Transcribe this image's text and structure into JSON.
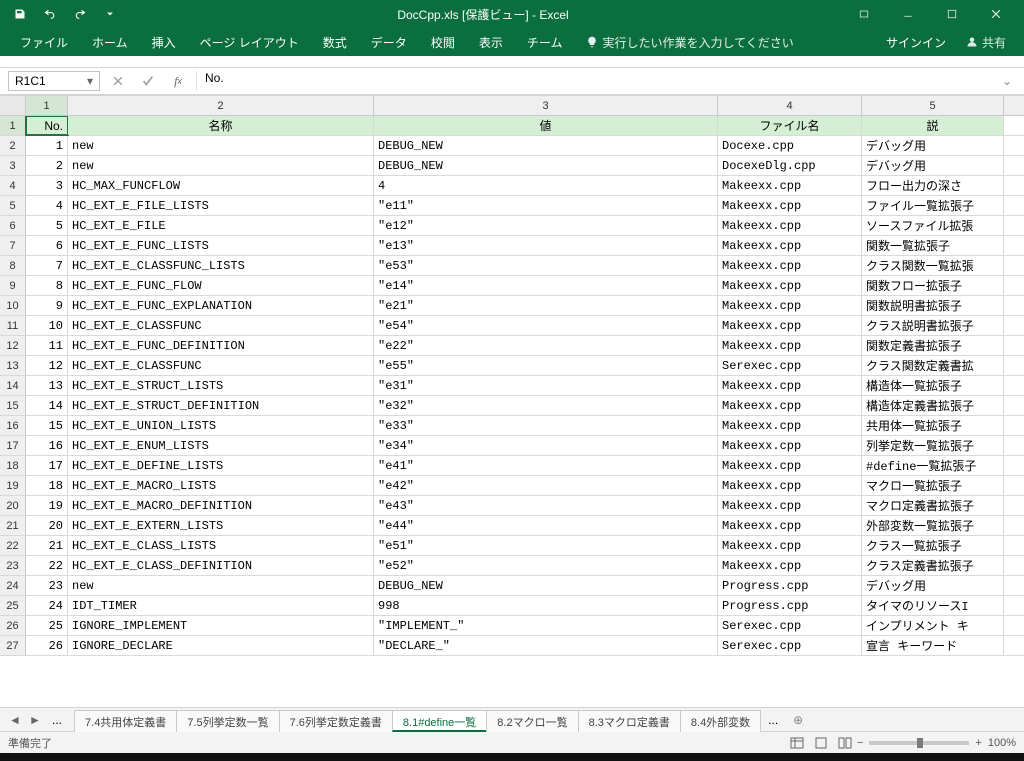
{
  "titlebar": {
    "title": "DocCpp.xls [保護ビュー] - Excel"
  },
  "ribbon": {
    "tabs": [
      "ファイル",
      "ホーム",
      "挿入",
      "ページ レイアウト",
      "数式",
      "データ",
      "校閲",
      "表示",
      "チーム"
    ],
    "tell": "実行したい作業を入力してください",
    "signin": "サインイン",
    "share": "共有"
  },
  "formulabar": {
    "namebox": "R1C1",
    "formula": "No."
  },
  "columns": {
    "labels": [
      "1",
      "2",
      "3",
      "4",
      "5"
    ]
  },
  "header_row": [
    "No.",
    "名称",
    "値",
    "ファイル名",
    "説"
  ],
  "rows": [
    {
      "n": "1",
      "a": "new",
      "b": "DEBUG_NEW",
      "c": "Docexe.cpp",
      "d": "デバッグ用"
    },
    {
      "n": "2",
      "a": "new",
      "b": "DEBUG_NEW",
      "c": "DocexeDlg.cpp",
      "d": "デバッグ用"
    },
    {
      "n": "3",
      "a": "HC_MAX_FUNCFLOW",
      "b": "4",
      "c": "Makeexx.cpp",
      "d": "フロー出力の深さ"
    },
    {
      "n": "4",
      "a": "HC_EXT_E_FILE_LISTS",
      "b": "\"e11\"",
      "c": "Makeexx.cpp",
      "d": "ファイル一覧拡張子"
    },
    {
      "n": "5",
      "a": "HC_EXT_E_FILE",
      "b": "\"e12\"",
      "c": "Makeexx.cpp",
      "d": "ソースファイル拡張"
    },
    {
      "n": "6",
      "a": "HC_EXT_E_FUNC_LISTS",
      "b": "\"e13\"",
      "c": "Makeexx.cpp",
      "d": "関数一覧拡張子"
    },
    {
      "n": "7",
      "a": "HC_EXT_E_CLASSFUNC_LISTS",
      "b": "\"e53\"",
      "c": "Makeexx.cpp",
      "d": "クラス関数一覧拡張"
    },
    {
      "n": "8",
      "a": "HC_EXT_E_FUNC_FLOW",
      "b": "\"e14\"",
      "c": "Makeexx.cpp",
      "d": "関数フロー拡張子"
    },
    {
      "n": "9",
      "a": "HC_EXT_E_FUNC_EXPLANATION",
      "b": "\"e21\"",
      "c": "Makeexx.cpp",
      "d": "関数説明書拡張子"
    },
    {
      "n": "10",
      "a": "HC_EXT_E_CLASSFUNC",
      "b": "\"e54\"",
      "c": "Makeexx.cpp",
      "d": "クラス説明書拡張子"
    },
    {
      "n": "11",
      "a": "HC_EXT_E_FUNC_DEFINITION",
      "b": "\"e22\"",
      "c": "Makeexx.cpp",
      "d": "関数定義書拡張子"
    },
    {
      "n": "12",
      "a": "HC_EXT_E_CLASSFUNC",
      "b": "\"e55\"",
      "c": "Serexec.cpp",
      "d": "クラス関数定義書拡"
    },
    {
      "n": "13",
      "a": "HC_EXT_E_STRUCT_LISTS",
      "b": "\"e31\"",
      "c": "Makeexx.cpp",
      "d": "構造体一覧拡張子"
    },
    {
      "n": "14",
      "a": "HC_EXT_E_STRUCT_DEFINITION",
      "b": "\"e32\"",
      "c": "Makeexx.cpp",
      "d": "構造体定義書拡張子"
    },
    {
      "n": "15",
      "a": "HC_EXT_E_UNION_LISTS",
      "b": "\"e33\"",
      "c": "Makeexx.cpp",
      "d": "共用体一覧拡張子"
    },
    {
      "n": "16",
      "a": "HC_EXT_E_ENUM_LISTS",
      "b": "\"e34\"",
      "c": "Makeexx.cpp",
      "d": "列挙定数一覧拡張子"
    },
    {
      "n": "17",
      "a": "HC_EXT_E_DEFINE_LISTS",
      "b": "\"e41\"",
      "c": "Makeexx.cpp",
      "d": "#define一覧拡張子"
    },
    {
      "n": "18",
      "a": "HC_EXT_E_MACRO_LISTS",
      "b": "\"e42\"",
      "c": "Makeexx.cpp",
      "d": "マクロ一覧拡張子"
    },
    {
      "n": "19",
      "a": "HC_EXT_E_MACRO_DEFINITION",
      "b": "\"e43\"",
      "c": "Makeexx.cpp",
      "d": "マクロ定義書拡張子"
    },
    {
      "n": "20",
      "a": "HC_EXT_E_EXTERN_LISTS",
      "b": "\"e44\"",
      "c": "Makeexx.cpp",
      "d": "外部変数一覧拡張子"
    },
    {
      "n": "21",
      "a": "HC_EXT_E_CLASS_LISTS",
      "b": "\"e51\"",
      "c": "Makeexx.cpp",
      "d": "クラス一覧拡張子"
    },
    {
      "n": "22",
      "a": "HC_EXT_E_CLASS_DEFINITION",
      "b": "\"e52\"",
      "c": "Makeexx.cpp",
      "d": "クラス定義書拡張子"
    },
    {
      "n": "23",
      "a": "new",
      "b": "DEBUG_NEW",
      "c": "Progress.cpp",
      "d": "デバッグ用"
    },
    {
      "n": "24",
      "a": "IDT_TIMER",
      "b": "998",
      "c": "Progress.cpp",
      "d": "タイマのリソースI"
    },
    {
      "n": "25",
      "a": "IGNORE_IMPLEMENT",
      "b": "\"IMPLEMENT_\"",
      "c": "Serexec.cpp",
      "d": "インプリメント キ"
    },
    {
      "n": "26",
      "a": "IGNORE_DECLARE",
      "b": "\"DECLARE_\"",
      "c": "Serexec.cpp",
      "d": "宣言 キーワード"
    }
  ],
  "sheet_tabs": {
    "ellipsis": "...",
    "tabs": [
      "7.4共用体定義書",
      "7.5列挙定数一覧",
      "7.6列挙定数定義書",
      "8.1#define一覧",
      "8.2マクロ一覧",
      "8.3マクロ定義書",
      "8.4外部変数"
    ],
    "active_index": 3,
    "trailing": "..."
  },
  "statusbar": {
    "ready": "準備完了",
    "zoom": "100%"
  }
}
